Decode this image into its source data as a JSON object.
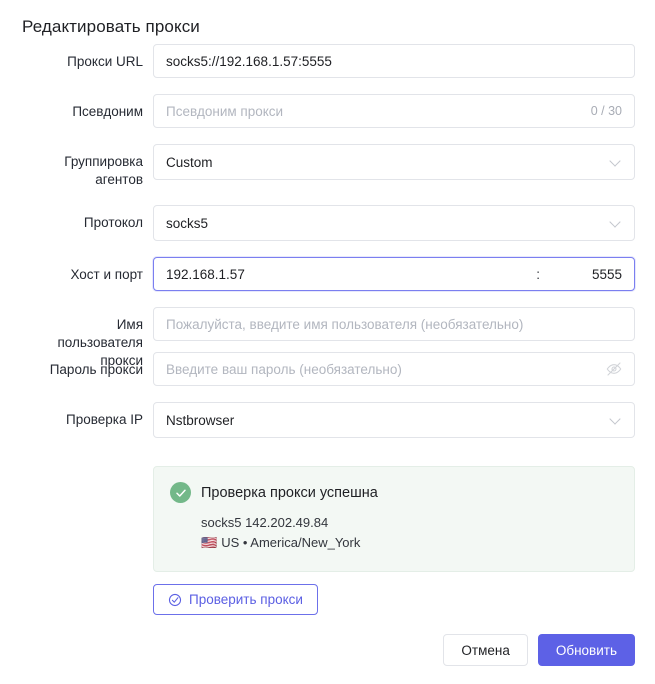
{
  "dialog": {
    "title": "Редактировать прокси"
  },
  "colors": {
    "accent": "#5d61e6",
    "focus_border": "#7b7ff0",
    "success_bg": "#f3f8f4",
    "success_icon": "#73b889",
    "border": "#e2e4e9",
    "placeholder": "#b2b6bf"
  },
  "fields": {
    "proxy_url": {
      "label": "Прокси URL",
      "value": "socks5://192.168.1.57:5555",
      "placeholder": ""
    },
    "alias": {
      "label": "Псевдоним",
      "value": "",
      "placeholder": "Псевдоним прокси",
      "counter": "0 / 30"
    },
    "agent_group": {
      "label": "Группировка\nагентов",
      "value": "Custom",
      "icon": "chevron-down-icon"
    },
    "protocol": {
      "label": "Протокол",
      "value": "socks5",
      "icon": "chevron-down-icon"
    },
    "host_port": {
      "label": "Хост и порт",
      "host": "192.168.1.57",
      "separator": ":",
      "port": "5555",
      "focused": true
    },
    "username": {
      "label": "Имя\nпользователя\nпрокси",
      "value": "",
      "placeholder": "Пожалуйста, введите имя пользователя (необязательно)"
    },
    "password": {
      "label": "Пароль прокси",
      "value": "",
      "placeholder": "Введите ваш пароль (необязательно)",
      "icon": "eye-off-icon"
    },
    "ip_check": {
      "label": "Проверка IP",
      "value": "Nstbrowser",
      "icon": "chevron-down-icon"
    }
  },
  "result": {
    "icon": "check-circle-filled-icon",
    "title": "Проверка прокси успешна",
    "protocol_ip": "socks5 142.202.49.84",
    "flag": "🇺🇸",
    "location": "US • America/New_York"
  },
  "actions": {
    "test_proxy": {
      "label": "Проверить прокси",
      "icon": "check-circle-outline-icon"
    },
    "cancel": "Отмена",
    "submit": "Обновить"
  }
}
